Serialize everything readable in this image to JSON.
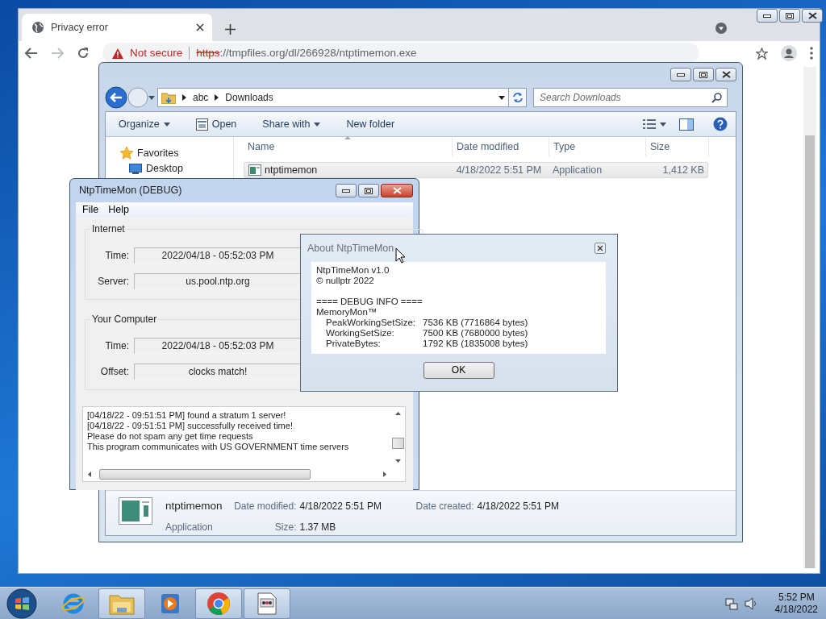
{
  "browser": {
    "tab": {
      "title": "Privacy error"
    },
    "security_label": "Not secure",
    "url_scheme": "https",
    "url_rest": "://tmpfiles.org/dl/266928/ntptimemon.exe"
  },
  "explorer": {
    "breadcrumb": [
      "abc",
      "Downloads"
    ],
    "search": {
      "placeholder": "Search Downloads"
    },
    "toolbar": [
      {
        "label": "Organize",
        "kind": "dropdown"
      },
      {
        "label": "Open",
        "kind": "icon"
      },
      {
        "label": "Share with",
        "kind": "dropdown"
      },
      {
        "label": "New folder",
        "kind": "plain"
      }
    ],
    "nav": [
      {
        "label": "Favorites",
        "kind": "favorites",
        "children": [
          {
            "label": "Desktop",
            "kind": "desktop"
          }
        ]
      }
    ],
    "columns": [
      "Name",
      "Date modified",
      "Type",
      "Size"
    ],
    "files": [
      {
        "name": "ntptimemon",
        "date_modified": "4/18/2022 5:51 PM",
        "type": "Application",
        "size": "1,412 KB",
        "selected": true
      }
    ],
    "details": {
      "name": "ntptimemon",
      "type": "Application",
      "rows": [
        [
          {
            "label": "Date modified:",
            "value": "4/18/2022 5:51 PM"
          },
          {
            "label": "Date created:",
            "value": "4/18/2022 5:51 PM"
          }
        ],
        [
          {
            "label": "Size:",
            "value": "1.37 MB"
          }
        ]
      ]
    }
  },
  "ntp_window": {
    "title": "NtpTimeMon (DEBUG)",
    "menu": [
      "File",
      "Help"
    ],
    "groups": [
      {
        "title": "Internet",
        "fields": [
          {
            "label": "Time:",
            "value": "2022/04/18 - 05:52:03 PM"
          },
          {
            "label": "Server:",
            "value": "us.pool.ntp.org"
          }
        ]
      },
      {
        "title": "Your Computer",
        "fields": [
          {
            "label": "Time:",
            "value": "2022/04/18 - 05:52:03 PM"
          },
          {
            "label": "Offset:",
            "value": "clocks match!"
          }
        ]
      }
    ],
    "log": [
      "[04/18/22 - 09:51:51 PM] found a stratum 1 server!",
      "[04/18/22 - 09:51:51 PM] successfully received time!",
      "Please do not spam any get time requests",
      "This program communicates with US GOVERNMENT time servers"
    ]
  },
  "about": {
    "title": "About NtpTimeMon",
    "lines": [
      "NtpTimeMon v1.0",
      "© nullptr 2022"
    ],
    "debug_header": "==== DEBUG INFO ====",
    "section": "MemoryMon™",
    "stats": [
      {
        "label": "PeakWorkingSetSize:",
        "value": "7536 KB (7716864 bytes)"
      },
      {
        "label": "WorkingSetSize:",
        "value": "7500 KB (7680000 bytes)"
      },
      {
        "label": "PrivateBytes:",
        "value": "1792 KB (1835008 bytes)"
      }
    ],
    "ok_button": "OK"
  },
  "taskbar": {
    "apps": [
      {
        "kind": "browser-e",
        "running": false
      },
      {
        "kind": "folder",
        "running": true
      },
      {
        "kind": "media",
        "running": false
      },
      {
        "kind": "chrome",
        "running": true
      },
      {
        "kind": "app",
        "running": true
      }
    ],
    "clock": {
      "time": "5:52 PM",
      "date": "4/18/2022"
    }
  }
}
